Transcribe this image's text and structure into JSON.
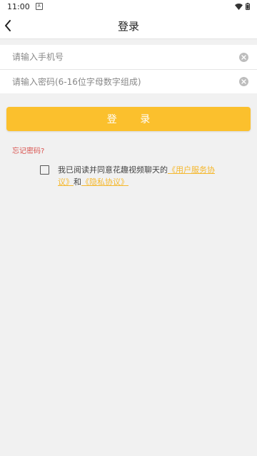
{
  "status_bar": {
    "time": "11:00",
    "notification_icon": "a-notification-icon",
    "wifi_icon": "wifi-icon",
    "battery_icon": "battery-icon"
  },
  "app_bar": {
    "back_icon": "chevron-left-icon",
    "title": "登录"
  },
  "form": {
    "phone_placeholder": "请输入手机号",
    "phone_value": "",
    "password_placeholder": "请输入密码(6-16位字母数字组成)",
    "password_value": "",
    "clear_icon": "clear-circle-icon"
  },
  "login_button": "登 录",
  "forgot_password": "忘记密码?",
  "agreement": {
    "checked": false,
    "prefix": "我已阅读并同意花趣视频聊天的",
    "user_agreement": "《用户服务协议》",
    "conjunction": "和",
    "privacy_policy": "《隐私协议》"
  },
  "colors": {
    "accent": "#fbc02d",
    "link": "#f5b82e",
    "forgot_text": "#d9534f",
    "background": "#f1f1f1"
  }
}
